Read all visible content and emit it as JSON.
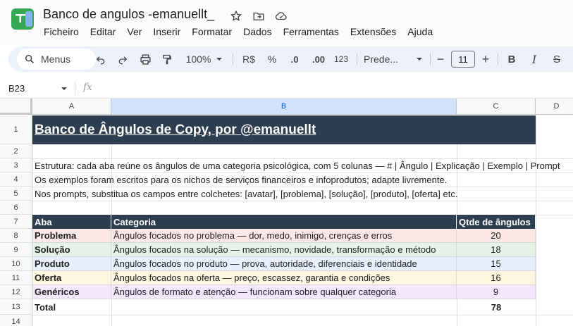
{
  "app": {
    "doc_title": "Banco de angulos -emanuellt_",
    "menu": [
      "Ficheiro",
      "Editar",
      "Ver",
      "Inserir",
      "Formatar",
      "Dados",
      "Ferramentas",
      "Extensões",
      "Ajuda"
    ]
  },
  "toolbar": {
    "search_label": "Menus",
    "zoom": "100%",
    "currency": "R$",
    "percent": "%",
    "dec_less": ".0",
    "dec_more": ".00",
    "number_format": "123",
    "font_name": "Prede...",
    "font_size": "11",
    "minus": "−",
    "plus": "+",
    "bold": "B",
    "italic": "I",
    "strike": "S"
  },
  "formula_bar": {
    "cell_ref": "B23",
    "fx": "fx"
  },
  "grid": {
    "columns": [
      "A",
      "B",
      "C",
      "D"
    ],
    "rows": [
      "1",
      "2",
      "3",
      "4",
      "5",
      "6",
      "7",
      "8",
      "9",
      "10",
      "11",
      "12",
      "13",
      "14"
    ],
    "banner": "Banco de Ângulos de Copy, por @emanuellt",
    "notes": [
      "Estrutura: cada aba reúne os ângulos de uma categoria psicológica, com 5 colunas — # | Ângulo | Explicação | Exemplo | Prompt",
      "Os exemplos foram escritos para os nichos de serviços financeiros e infoprodutos; adapte livremente.",
      "Nos prompts, substitua os campos entre colchetes: [avatar], [problema], [solução], [produto], [oferta] etc."
    ],
    "table_headers": [
      "Aba",
      "Categoria",
      "Qtde de ângulos"
    ],
    "table_rows": [
      {
        "aba": "Problema",
        "categoria": "Ângulos focados no problema — dor, medo, inimigo, crenças e erros",
        "qtde": "20",
        "color": "#fce8e6"
      },
      {
        "aba": "Solução",
        "categoria": "Ângulos focados na solução — mecanismo, novidade, transformação e método",
        "qtde": "18",
        "color": "#e6f4ea"
      },
      {
        "aba": "Produto",
        "categoria": "Ângulos focados no produto — prova, autoridade, diferenciais e identidade",
        "qtde": "15",
        "color": "#e8f0fe"
      },
      {
        "aba": "Oferta",
        "categoria": "Ângulos focados na oferta — preço, escassez, garantia e condições",
        "qtde": "16",
        "color": "#fef7e0"
      },
      {
        "aba": "Genéricos",
        "categoria": "Ângulos de formato e atenção — funcionam sobre qualquer categoria",
        "qtde": "9",
        "color": "#f3e8fd"
      }
    ],
    "total_label": "Total",
    "total_value": "78"
  },
  "colors": {
    "header_dark": "#2c3e50",
    "selected_col": "#d3e3fd"
  }
}
